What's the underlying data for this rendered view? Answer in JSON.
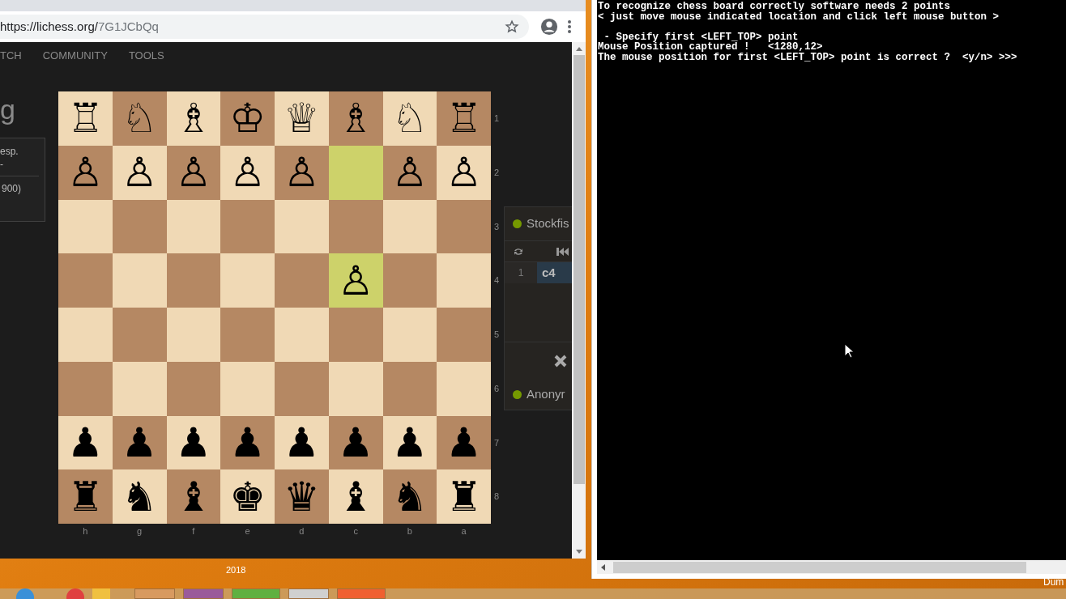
{
  "browser": {
    "url_host": "https://lichess.org/",
    "url_path": "7G1JCbQq",
    "nav": [
      "TCH",
      "COMMUNITY",
      "TOOLS"
    ],
    "heading": "g",
    "info_lines": [
      "esp.",
      "-"
    ],
    "rating": "900)",
    "board": {
      "rows": [
        [
          {
            "piece": "♖",
            "highlighted": false
          },
          {
            "piece": "♘",
            "highlighted": false
          },
          {
            "piece": "♗",
            "highlighted": false
          },
          {
            "piece": "♔",
            "highlighted": false
          },
          {
            "piece": "♕",
            "highlighted": false
          },
          {
            "piece": "♗",
            "highlighted": false
          },
          {
            "piece": "♘",
            "highlighted": false
          },
          {
            "piece": "♖",
            "highlighted": false
          }
        ],
        [
          {
            "piece": "♙",
            "highlighted": false
          },
          {
            "piece": "♙",
            "highlighted": false
          },
          {
            "piece": "♙",
            "highlighted": false
          },
          {
            "piece": "♙",
            "highlighted": false
          },
          {
            "piece": "♙",
            "highlighted": false
          },
          {
            "highlighted": true
          },
          {
            "piece": "♙",
            "highlighted": false
          },
          {
            "piece": "♙",
            "highlighted": false
          }
        ],
        [
          {
            "highlighted": false
          },
          {
            "highlighted": false
          },
          {
            "highlighted": false
          },
          {
            "highlighted": false
          },
          {
            "highlighted": false
          },
          {
            "highlighted": false
          },
          {
            "highlighted": false
          },
          {
            "highlighted": false
          }
        ],
        [
          {
            "highlighted": false
          },
          {
            "highlighted": false
          },
          {
            "highlighted": false
          },
          {
            "highlighted": false
          },
          {
            "highlighted": false
          },
          {
            "piece": "♙",
            "highlighted": true
          },
          {
            "highlighted": false
          },
          {
            "highlighted": false
          }
        ],
        [
          {
            "highlighted": false
          },
          {
            "highlighted": false
          },
          {
            "highlighted": false
          },
          {
            "highlighted": false
          },
          {
            "highlighted": false
          },
          {
            "highlighted": false
          },
          {
            "highlighted": false
          },
          {
            "highlighted": false
          }
        ],
        [
          {
            "highlighted": false
          },
          {
            "highlighted": false
          },
          {
            "highlighted": false
          },
          {
            "highlighted": false
          },
          {
            "highlighted": false
          },
          {
            "highlighted": false
          },
          {
            "highlighted": false
          },
          {
            "highlighted": false
          }
        ],
        [
          {
            "piece": "♟",
            "highlighted": false
          },
          {
            "piece": "♟",
            "highlighted": false
          },
          {
            "piece": "♟",
            "highlighted": false
          },
          {
            "piece": "♟",
            "highlighted": false
          },
          {
            "piece": "♟",
            "highlighted": false
          },
          {
            "piece": "♟",
            "highlighted": false
          },
          {
            "piece": "♟",
            "highlighted": false
          },
          {
            "piece": "♟",
            "highlighted": false
          }
        ],
        [
          {
            "piece": "♜",
            "highlighted": false
          },
          {
            "piece": "♞",
            "highlighted": false
          },
          {
            "piece": "♝",
            "highlighted": false
          },
          {
            "piece": "♚",
            "highlighted": false
          },
          {
            "piece": "♛",
            "highlighted": false
          },
          {
            "piece": "♝",
            "highlighted": false
          },
          {
            "piece": "♞",
            "highlighted": false
          },
          {
            "piece": "♜",
            "highlighted": false
          }
        ]
      ],
      "ranks": [
        "1",
        "2",
        "3",
        "4",
        "5",
        "6",
        "7",
        "8"
      ],
      "files": [
        "h",
        "g",
        "f",
        "e",
        "d",
        "c",
        "b",
        "a"
      ]
    },
    "players": [
      {
        "name": "Stockfis",
        "online": true
      },
      {
        "name": "Anonyr",
        "online": true
      }
    ],
    "moves": [
      {
        "number": "1",
        "move": "c4",
        "selected": true
      }
    ]
  },
  "console": {
    "blocks": [
      [
        "To recognize chess board correctly software needs 2 points",
        "< just move mouse indicated location and click left mouse button >"
      ],
      [
        " - Specify first <LEFT_TOP> point",
        "Mouse Position captured !   <1280,12>",
        "The mouse position for first <LEFT_TOP> point is correct ?  <y/n> >>>"
      ]
    ]
  },
  "desktop": {
    "label": "2018",
    "corner_text": "Dum"
  }
}
